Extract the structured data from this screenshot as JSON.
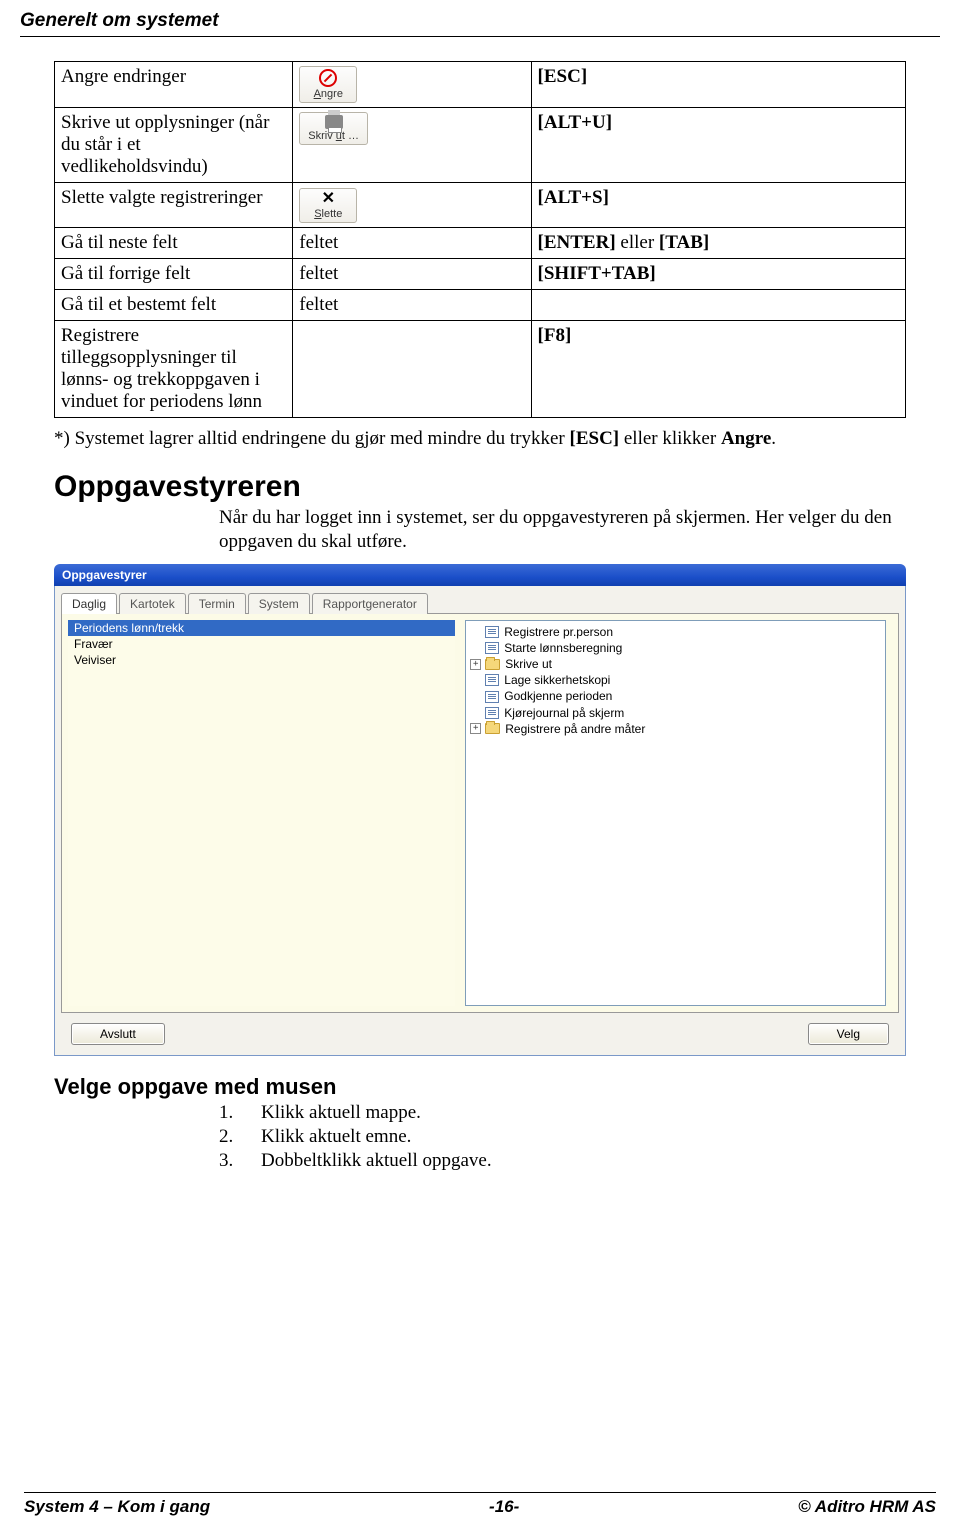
{
  "header": {
    "title": "Generelt om systemet"
  },
  "table": {
    "rows": [
      {
        "c1": "Angre endringer",
        "c2_btn": {
          "label_pre": "",
          "label_u": "A",
          "label_post": "ngre",
          "icon": "cancel"
        },
        "c3": "[ESC]"
      },
      {
        "c1": "Skrive ut opplysninger (når du står i et vedlikeholdsvindu)",
        "c2_btn": {
          "label_pre": "Skriv ",
          "label_u": "u",
          "label_post": "t …",
          "icon": "print"
        },
        "c3": "[ALT+U]"
      },
      {
        "c1": "Slette valgte registreringer",
        "c2_btn": {
          "label_pre": "",
          "label_u": "S",
          "label_post": "lette",
          "icon": "x"
        },
        "c3": "[ALT+S]"
      },
      {
        "c1": "Gå til neste felt",
        "c2_text": "feltet",
        "c3_html_parts": [
          "[ENTER]",
          " eller ",
          "[TAB]"
        ]
      },
      {
        "c1": "Gå til forrige felt",
        "c2_text": "feltet",
        "c3": "[SHIFT+TAB]"
      },
      {
        "c1": "Gå til et bestemt felt",
        "c2_text": "feltet",
        "c3": ""
      },
      {
        "c1": "Registrere tilleggsopplysninger til lønns- og trekkoppgaven i vinduet for periodens lønn",
        "c2_text": "",
        "c3": "[F8]"
      }
    ]
  },
  "note_parts": [
    "*) Systemet lagrer alltid endringene du gjør med mindre du trykker ",
    "[ESC]",
    " eller klikker ",
    "Angre",
    "."
  ],
  "section1": {
    "heading": "Oppgavestyreren",
    "text": "Når du har logget inn i systemet, ser du oppgavestyreren på skjermen. Her velger du den oppgaven du skal utføre."
  },
  "app_window": {
    "title": "Oppgavestyrer",
    "tabs": [
      "Daglig",
      "Kartotek",
      "Termin",
      "System",
      "Rapportgenerator"
    ],
    "active_tab": 0,
    "left_items": [
      {
        "label": "Periodens lønn/trekk",
        "selected": true
      },
      {
        "label": "Fravær",
        "selected": false
      },
      {
        "label": "Veiviser",
        "selected": false
      }
    ],
    "right_items": [
      {
        "icon": "file",
        "label": "Registrere pr.person",
        "expand": null
      },
      {
        "icon": "file",
        "label": "Starte lønnsberegning",
        "expand": null
      },
      {
        "icon": "folder",
        "label": "Skrive ut",
        "expand": "+"
      },
      {
        "icon": "file",
        "label": "Lage sikkerhetskopi",
        "expand": null
      },
      {
        "icon": "file",
        "label": "Godkjenne perioden",
        "expand": null
      },
      {
        "icon": "file",
        "label": "Kjørejournal på skjerm",
        "expand": null
      },
      {
        "icon": "folder",
        "label": "Registrere på andre måter",
        "expand": "+"
      }
    ],
    "buttons": {
      "left": "Avslutt",
      "right": "Velg"
    }
  },
  "section2": {
    "heading": "Velge oppgave med musen",
    "steps": [
      {
        "n": "1.",
        "t": "Klikk aktuell mappe."
      },
      {
        "n": "2.",
        "t": "Klikk aktuelt emne."
      },
      {
        "n": "3.",
        "t": "Dobbeltklikk aktuell oppgave."
      }
    ]
  },
  "footer": {
    "left": "System 4 – Kom i gang",
    "center": "-16-",
    "right": "© Aditro HRM AS"
  }
}
